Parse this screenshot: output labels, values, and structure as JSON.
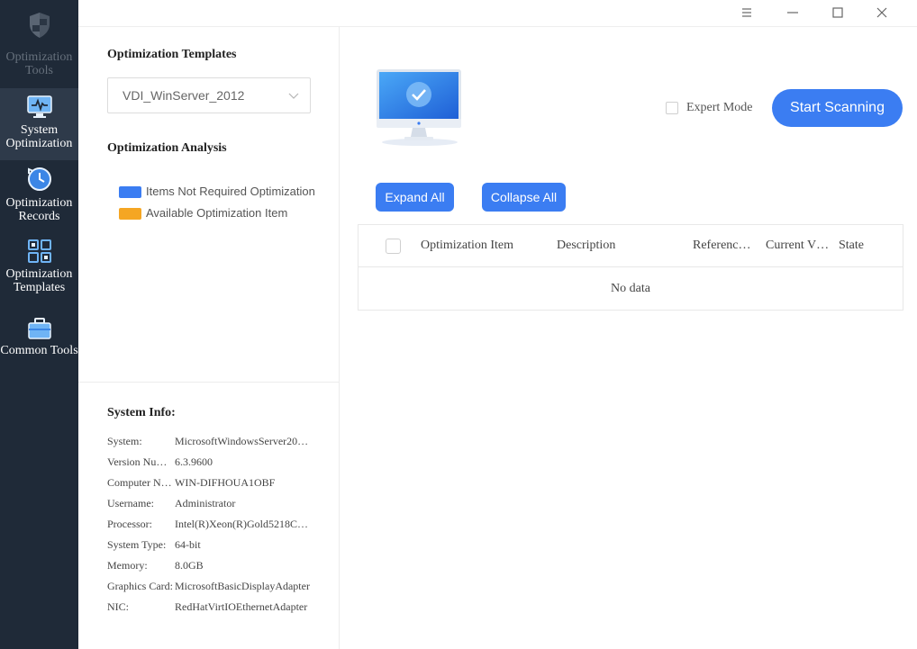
{
  "sidebar": {
    "brand_line1": "Optimization",
    "brand_line2": "Tools",
    "items": [
      {
        "line1": "System",
        "line2": "Optimization",
        "icon": "monitor-pulse-icon",
        "active": true
      },
      {
        "line1": "Optimization",
        "line2": "Records",
        "icon": "clock-history-icon",
        "active": false
      },
      {
        "line1": "Optimization",
        "line2": "Templates",
        "icon": "template-grid-icon",
        "active": false
      },
      {
        "line1": "Common Tools",
        "line2": "",
        "icon": "toolbox-icon",
        "active": false
      }
    ]
  },
  "window": {
    "controls": [
      "menu-icon",
      "minimize-icon",
      "maximize-icon",
      "close-icon"
    ]
  },
  "left_panel": {
    "templates_title": "Optimization Templates",
    "template_selected": "VDI_WinServer_2012",
    "analysis_title": "Optimization Analysis",
    "legend": [
      {
        "label": "Items Not Required Optimization",
        "color": "#3b7df2"
      },
      {
        "label": "Available Optimization Item",
        "color": "#f5a623"
      }
    ],
    "system_info_title": "System Info:",
    "system_info": [
      {
        "key": "System:",
        "value": "MicrosoftWindowsServer20…"
      },
      {
        "key": "Version Nu…",
        "value": "6.3.9600"
      },
      {
        "key": "Computer N…",
        "value": "WIN-DIFHOUA1OBF"
      },
      {
        "key": "Username:",
        "value": "Administrator"
      },
      {
        "key": "Processor:",
        "value": "Intel(R)Xeon(R)Gold5218C…"
      },
      {
        "key": "System Type:",
        "value": "64-bit"
      },
      {
        "key": "Memory:",
        "value": "8.0GB"
      },
      {
        "key": "Graphics Card:",
        "value": "MicrosoftBasicDisplayAdapter"
      },
      {
        "key": "NIC:",
        "value": "RedHatVirtIOEthernetAdapter"
      }
    ]
  },
  "main": {
    "expert_mode_label": "Expert Mode",
    "start_scan_label": "Start Scanning",
    "expand_all_label": "Expand All",
    "collapse_all_label": "Collapse All",
    "table": {
      "columns": [
        "Optimization Item",
        "Description",
        "Referenc…",
        "Current V…",
        "State"
      ],
      "empty_text": "No data"
    }
  },
  "colors": {
    "sidebar_bg": "#1f2a38",
    "sidebar_active": "#2e3a4a",
    "accent": "#3b7df2",
    "warning": "#f5a623"
  }
}
